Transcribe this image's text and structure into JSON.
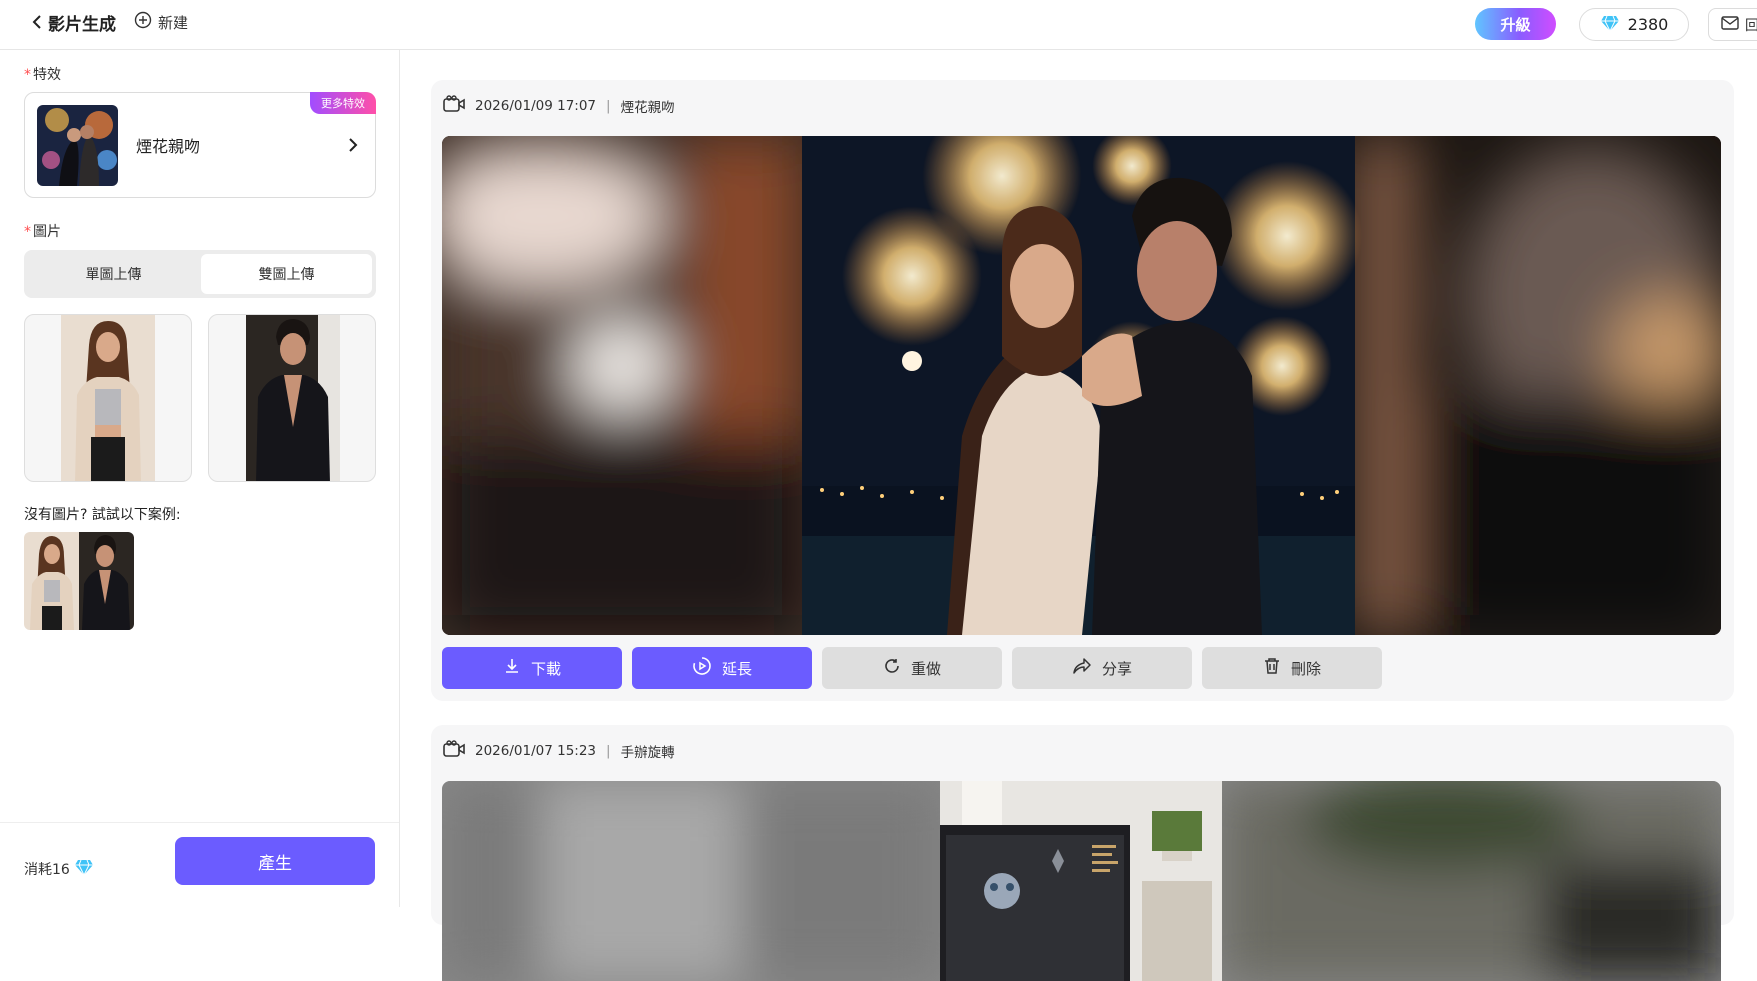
{
  "header": {
    "title": "影片生成",
    "new_label": "新建",
    "upgrade_label": "升級",
    "credits": "2380",
    "mail_label": "回"
  },
  "sidebar": {
    "effect_label": "特效",
    "effect_name": "煙花親吻",
    "more_effects_badge": "更多特效",
    "image_label": "圖片",
    "upload_modes": [
      "單圖上傳",
      "雙圖上傳"
    ],
    "active_mode": "雙圖上傳",
    "example_prompt": "沒有圖片? 試試以下案例:",
    "cost_label": "消耗16",
    "generate_label": "產生"
  },
  "feed": [
    {
      "timestamp": "2026/01/09 17:07",
      "effect": "煙花親吻",
      "actions": [
        "下載",
        "延長",
        "重做",
        "分享",
        "刪除"
      ]
    },
    {
      "timestamp": "2026/01/07 15:23",
      "effect": "手辦旋轉"
    }
  ],
  "colors": {
    "accent": "#6b5cff",
    "required": "#ff4d4f",
    "badge_gradient_start": "#a14dff",
    "badge_gradient_end": "#ff4fa8"
  },
  "icons": [
    "back-chevron-icon",
    "plus-circle-icon",
    "diamond-icon",
    "mail-icon",
    "video-camera-icon",
    "download-icon",
    "extend-play-icon",
    "redo-icon",
    "share-icon",
    "trash-icon"
  ]
}
